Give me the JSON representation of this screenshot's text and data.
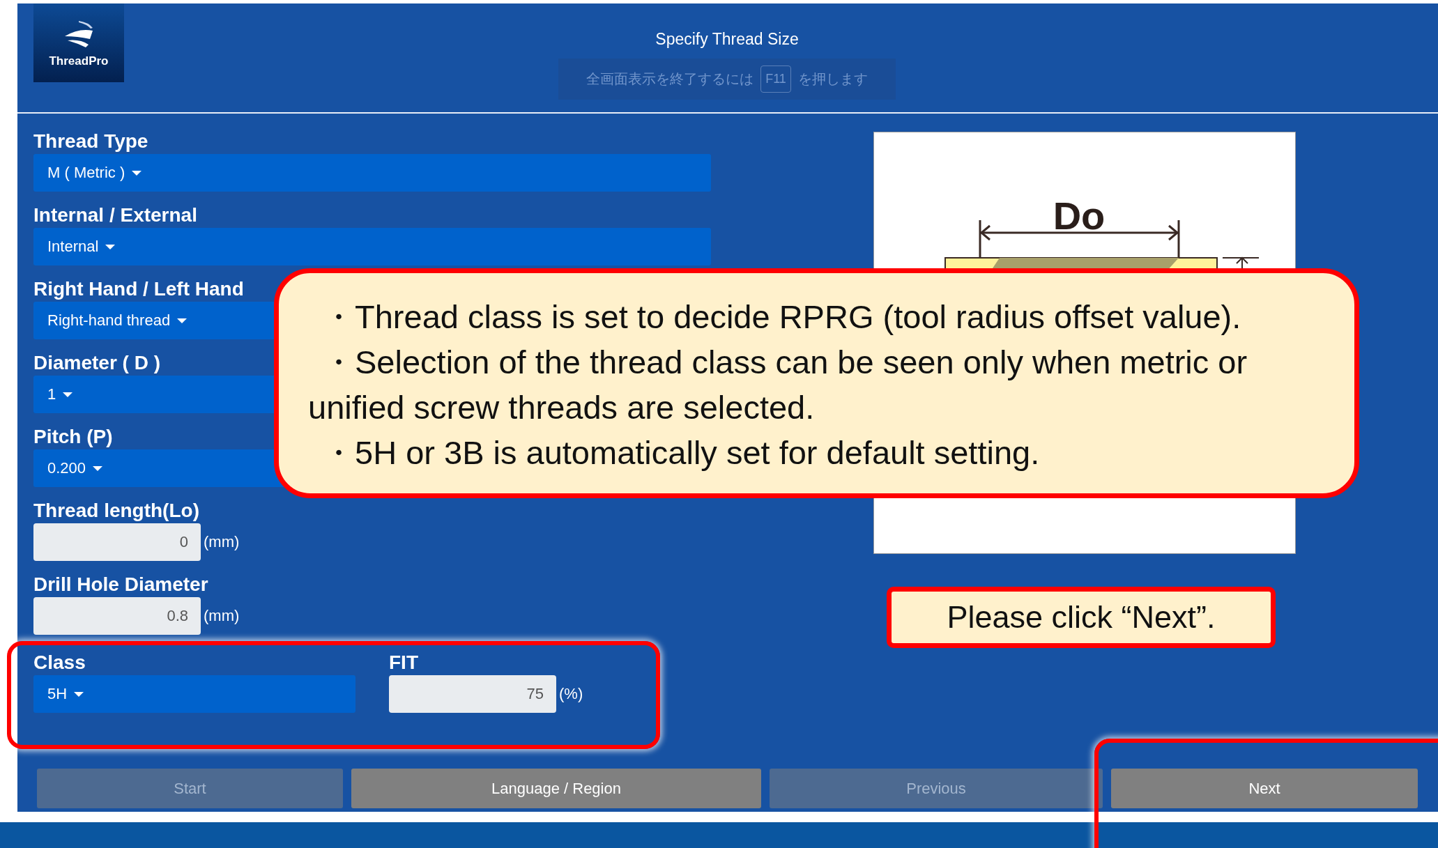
{
  "header": {
    "logo_text": "ThreadPro",
    "title": "Specify Thread Size",
    "fullscreen_hint": {
      "before": "全画面表示を終了するには",
      "key": "F11",
      "after": "を押します"
    }
  },
  "fields": [
    {
      "kind": "select",
      "label": "Thread Type",
      "value": "M ( Metric )"
    },
    {
      "kind": "select",
      "label": "Internal / External",
      "value": "Internal"
    },
    {
      "kind": "select",
      "label": "Right Hand / Left Hand",
      "value": "Right-hand thread"
    },
    {
      "kind": "select",
      "label": "Diameter ( D )",
      "value": "1"
    },
    {
      "kind": "select",
      "label": "Pitch (P)",
      "value": "0.200"
    },
    {
      "kind": "number",
      "label": "Thread length(Lo)",
      "value": "0",
      "unit": "(mm)"
    },
    {
      "kind": "number",
      "label": "Drill Hole Diameter",
      "value": "0.8",
      "unit": "(mm)"
    }
  ],
  "class_row": [
    {
      "kind": "select",
      "label": "Class",
      "value": "5H"
    },
    {
      "kind": "number",
      "label": "FIT",
      "value": "75",
      "unit": "(%)"
    }
  ],
  "diagram": {
    "dimension_label": "Do"
  },
  "callouts": {
    "main": [
      {
        "text": "・Thread class is set to decide RPRG (tool radius offset value).",
        "indent": true
      },
      {
        "text": "・Selection of the thread class can be seen only when metric or",
        "indent": true
      },
      {
        "text": "unified screw threads are selected.",
        "indent": false
      },
      {
        "text": "・5H or 3B is automatically set for default setting.",
        "indent": true
      }
    ],
    "next": "Please click “Next”."
  },
  "buttons": [
    {
      "label": "Start",
      "disabled": true
    },
    {
      "label": "Language / Region",
      "disabled": false
    },
    {
      "label": "Previous",
      "disabled": true
    },
    {
      "label": "Next",
      "disabled": false
    }
  ]
}
